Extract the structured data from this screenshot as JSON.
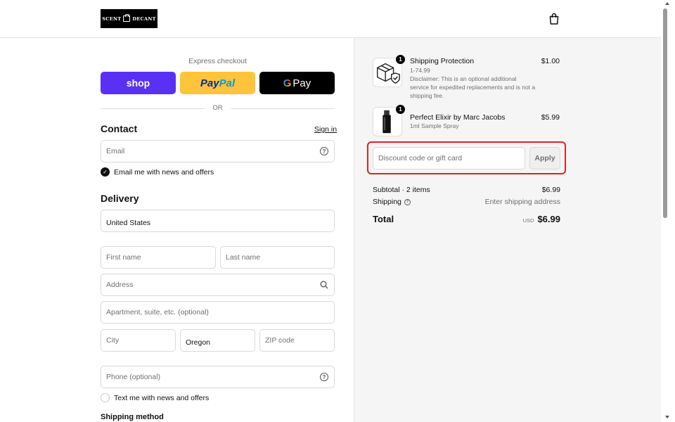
{
  "brand": {
    "logo_left": "SCENT",
    "logo_right": "DECANT"
  },
  "express": {
    "label": "Express checkout",
    "shop_label": "shop",
    "paypal_label_1": "Pay",
    "paypal_label_2": "Pal",
    "gpay_g": "G",
    "gpay_label": "Pay",
    "or_label": "OR"
  },
  "contact": {
    "heading": "Contact",
    "sign_in": "Sign in",
    "email_placeholder": "Email",
    "news_checkbox": "Email me with news and offers"
  },
  "delivery": {
    "heading": "Delivery",
    "country": "United States",
    "first_name": "First name",
    "last_name": "Last name",
    "address": "Address",
    "apartment": "Apartment, suite, etc. (optional)",
    "city": "City",
    "state": "Oregon",
    "zip": "ZIP code",
    "phone": "Phone (optional)",
    "sms_checkbox": "Text me with news and offers"
  },
  "shipping_method": {
    "heading": "Shipping method"
  },
  "summary": {
    "items": [
      {
        "title": "Shipping Protection",
        "variant": "1-74.99",
        "description": "Disclaimer: This is an optional additional service for expedited replacements and is not a shipping fee.",
        "price": "$1.00",
        "quantity": "1"
      },
      {
        "title": "Perfect Elixir by Marc Jacobs",
        "variant": "1ml Sample Spray",
        "price": "$5.99",
        "quantity": "1"
      }
    ],
    "discount_placeholder": "Discount code or gift card",
    "apply_label": "Apply",
    "subtotal_label": "Subtotal · 2 items",
    "subtotal_value": "$6.99",
    "shipping_label": "Shipping",
    "shipping_value": "Enter shipping address",
    "total_label": "Total",
    "currency": "USD",
    "total_value": "$6.99"
  },
  "colors": {
    "shop": "#5a31f4",
    "paypal": "#ffc439",
    "highlight": "#e0202c"
  }
}
